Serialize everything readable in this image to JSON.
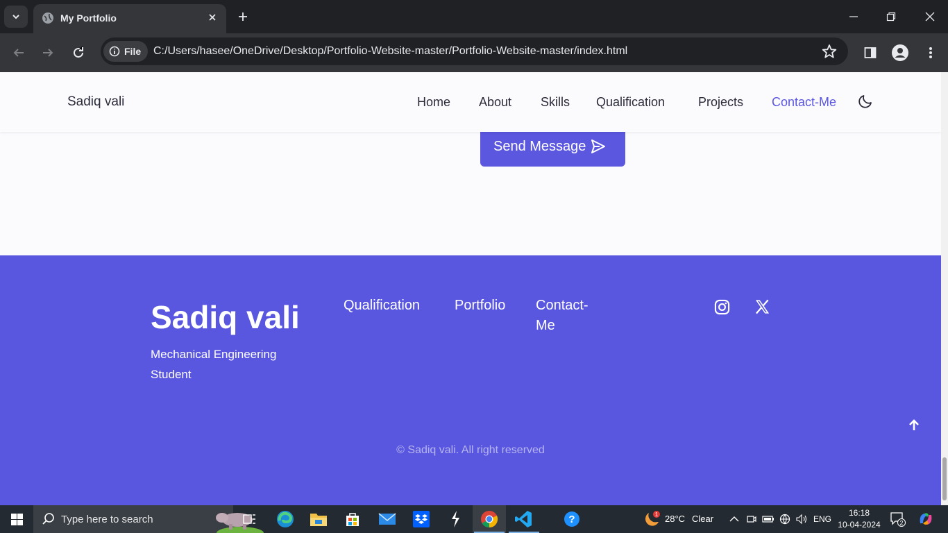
{
  "browser": {
    "tab_title": "My Portfolio",
    "url_chip_label": "File",
    "url": "C:/Users/hasee/OneDrive/Desktop/Portfolio-Website-master/Portfolio-Website-master/index.html"
  },
  "site": {
    "brand": "Sadiq vali",
    "nav": [
      {
        "label": "Home"
      },
      {
        "label": "About"
      },
      {
        "label": "Skills"
      },
      {
        "label": "Qualification"
      },
      {
        "label": "Projects"
      },
      {
        "label": "Contact-Me",
        "active": true
      }
    ],
    "send_button": "Send Message",
    "footer": {
      "title": "Sadiq vali",
      "subtitle": "Mechanical Engineering Student",
      "links": [
        "Qualification",
        "Portfolio",
        "Contact-Me"
      ],
      "social": [
        "instagram-icon",
        "x-twitter-icon"
      ],
      "copyright": "© Sadiq vali. All right reserved"
    }
  },
  "taskbar": {
    "search_placeholder": "Type here to search",
    "weather_temp": "28°C",
    "weather_desc": "Clear",
    "weather_badge": "1",
    "language": "ENG",
    "time": "16:18",
    "date": "10-04-2024",
    "notification_count": "2"
  },
  "colors": {
    "accent": "#5b57df",
    "footer_bg": "#5957e0",
    "chrome_dark": "#202124"
  }
}
